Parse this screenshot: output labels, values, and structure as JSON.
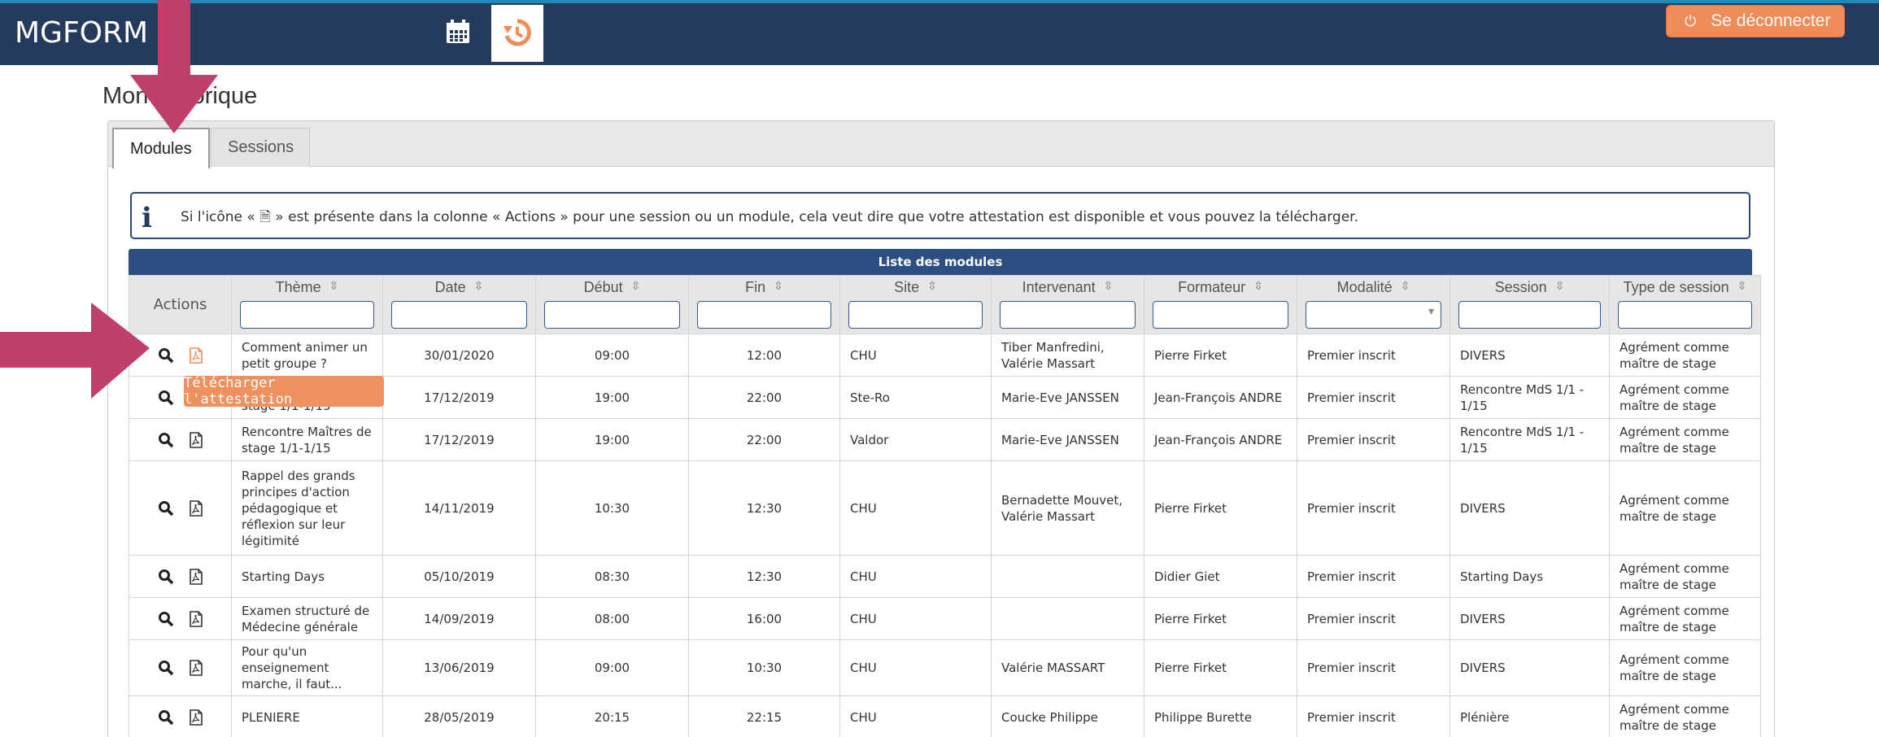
{
  "navbar": {
    "brand": "MGFORM",
    "logout_label": "Se déconnecter"
  },
  "page": {
    "title": "Mon historique"
  },
  "tabs": [
    {
      "label": "Modules",
      "active": true
    },
    {
      "label": "Sessions",
      "active": false
    }
  ],
  "info": {
    "text": "Si l'icône « 🗎 » est présente dans la colonne « Actions » pour une session ou un module, cela veut dire que votre attestation est disponible et vous pouvez la télécharger."
  },
  "table": {
    "caption": "Liste des modules",
    "headers": [
      "Actions",
      "Thème",
      "Date",
      "Début",
      "Fin",
      "Site",
      "Intervenant",
      "Formateur",
      "Modalité",
      "Session",
      "Type de session"
    ],
    "sort_glyph": "⇳",
    "rows": [
      [
        "",
        "Comment animer un petit groupe ?",
        "30/01/2020",
        "09:00",
        "12:00",
        "CHU",
        "Tiber Manfredini, Valérie Massart",
        "Pierre Firket",
        "Premier inscrit",
        "DIVERS",
        "Agrément comme maître de stage"
      ],
      [
        "",
        "Rencontre Maîtres de stage 1/1-1/15",
        "17/12/2019",
        "19:00",
        "22:00",
        "Ste-Ro",
        "Marie-Eve JANSSEN",
        "Jean-François ANDRE",
        "Premier inscrit",
        "Rencontre MdS 1/1 - 1/15",
        "Agrément comme maître de stage"
      ],
      [
        "",
        "Rencontre Maîtres de stage 1/1-1/15",
        "17/12/2019",
        "19:00",
        "22:00",
        "Valdor",
        "Marie-Eve JANSSEN",
        "Jean-François ANDRE",
        "Premier inscrit",
        "Rencontre MdS 1/1 - 1/15",
        "Agrément comme maître de stage"
      ],
      [
        "",
        "Rappel des grands principes d'action pédagogique et réflexion sur leur légitimité",
        "14/11/2019",
        "10:30",
        "12:30",
        "CHU",
        "Bernadette Mouvet, Valérie Massart",
        "Pierre Firket",
        "Premier inscrit",
        "DIVERS",
        "Agrément comme maître de stage"
      ],
      [
        "",
        "Starting Days",
        "05/10/2019",
        "08:30",
        "12:30",
        "CHU",
        "",
        "Didier Giet",
        "Premier inscrit",
        "Starting Days",
        "Agrément comme maître de stage"
      ],
      [
        "",
        "Examen structuré de Médecine générale",
        "14/09/2019",
        "08:00",
        "16:00",
        "CHU",
        "",
        "Pierre Firket",
        "Premier inscrit",
        "DIVERS",
        "Agrément comme maître de stage"
      ],
      [
        "",
        "Pour qu'un enseignement marche, il faut...",
        "13/06/2019",
        "09:00",
        "10:30",
        "CHU",
        "Valérie MASSART",
        "Pierre Firket",
        "Premier inscrit",
        "DIVERS",
        "Agrément comme maître de stage"
      ],
      [
        "",
        "PLENIERE",
        "28/05/2019",
        "20:15",
        "22:15",
        "CHU",
        "Coucke Philippe",
        "Philippe Burette",
        "Premier inscrit",
        "Plénière",
        "Agrément comme maître de stage"
      ]
    ]
  },
  "tooltip": {
    "text": "Télécharger l'attestation"
  },
  "icons": [
    "calendar-icon",
    "history-icon",
    "power-icon",
    "info-icon",
    "search-icon",
    "pdf-icon",
    "sort-icon"
  ],
  "colors": {
    "navbar": "#243b5e",
    "accent": "#f08b5a",
    "table_header": "#2c4f82",
    "annotation_arrow": "#c0406c"
  }
}
